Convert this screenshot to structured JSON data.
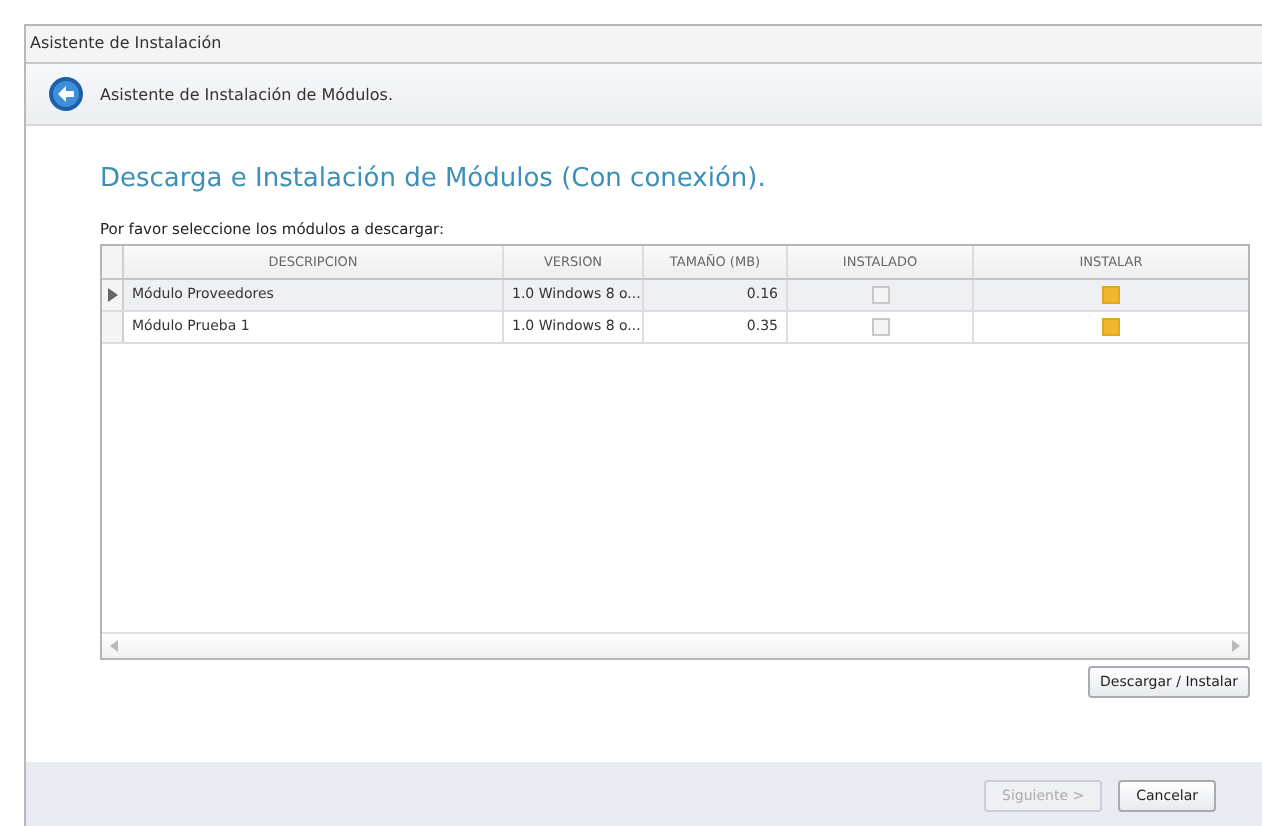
{
  "window": {
    "title": "Asistente de Instalación"
  },
  "header": {
    "title": "Asistente de Instalación de Módulos."
  },
  "heading": "Descarga e Instalación de Módulos (Con conexión).",
  "prompt": "Por favor seleccione los módulos a descargar:",
  "table": {
    "columns": [
      "DESCRIPCION",
      "VERSION",
      "TAMAÑO (MB)",
      "INSTALADO",
      "INSTALAR"
    ],
    "rows": [
      {
        "selected": true,
        "descripcion": "Módulo Proveedores",
        "version": "1.0 Windows 8 o...",
        "tamano": "0.16",
        "instalado": false,
        "instalar": true
      },
      {
        "selected": false,
        "descripcion": "Módulo Prueba 1",
        "version": "1.0 Windows 8 o...",
        "tamano": "0.35",
        "instalado": false,
        "instalar": true
      }
    ]
  },
  "action_button": "Descargar / Instalar",
  "footer_buttons": [
    {
      "label": "Siguiente >",
      "disabled": true
    },
    {
      "label": "Cancelar",
      "disabled": false
    }
  ]
}
